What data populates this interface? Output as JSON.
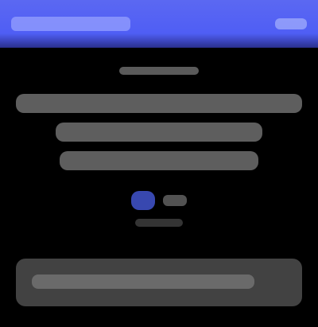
{
  "colors": {
    "topbar": "#5563f3",
    "background": "#000000",
    "accent": "#4b5ddb"
  },
  "icons": {
    "brand": "brand-logo",
    "topbar_right": "menu-icon",
    "cta": "play-icon"
  }
}
